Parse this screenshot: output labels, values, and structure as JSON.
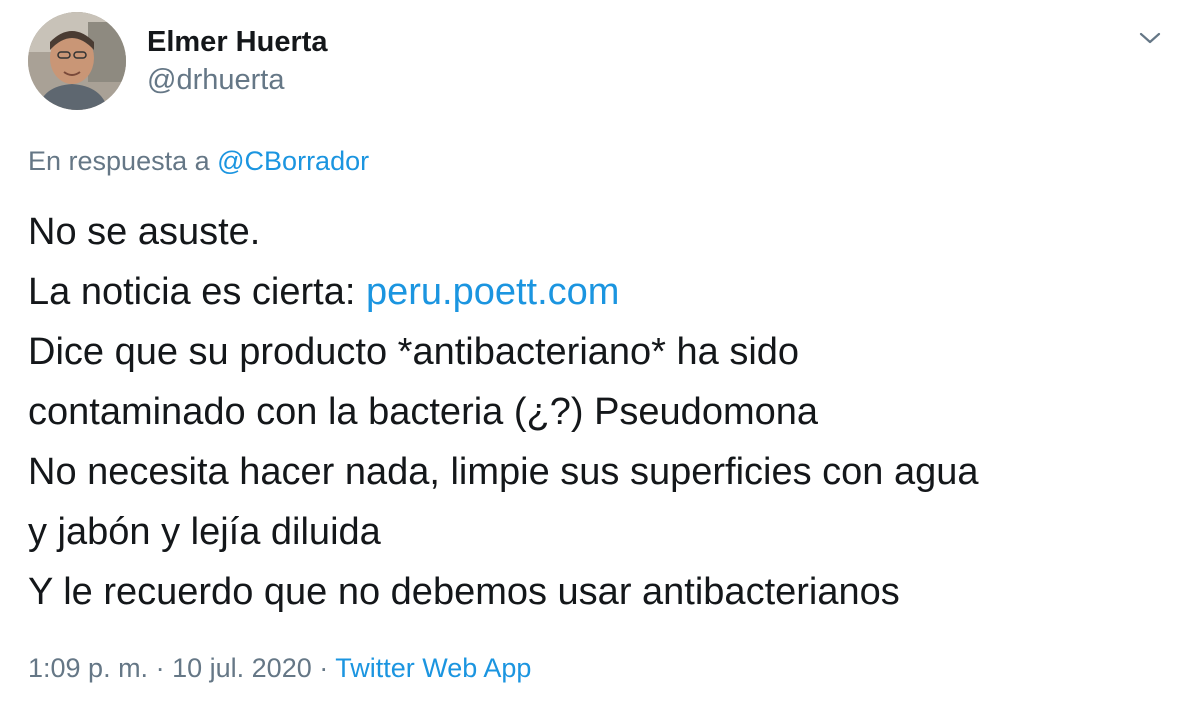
{
  "author": {
    "name": "Elmer Huerta",
    "handle": "@drhuerta"
  },
  "reply": {
    "prefix": "En respuesta a",
    "mention": "@CBorrador"
  },
  "tweet": {
    "line1": "No se asuste.",
    "line2_text": "La noticia es cierta: ",
    "line2_link": "peru.poett.com",
    "line3": "Dice que su producto *antibacteriano* ha sido",
    "line4": "contaminado con la bacteria (¿?) Pseudomona",
    "line5": "No necesita hacer nada, limpie sus superficies con agua",
    "line6": "y jabón y lejía diluida",
    "line7": "Y le recuerdo que no debemos usar antibacterianos"
  },
  "meta": {
    "time": "1:09 p. m.",
    "date": "10 jul. 2020",
    "separator": "·",
    "source": "Twitter Web App"
  },
  "colors": {
    "link": "#1b95e0",
    "secondary_text": "#657786",
    "primary_text": "#14171a"
  },
  "icons": {
    "menu": "chevron-down-icon"
  }
}
